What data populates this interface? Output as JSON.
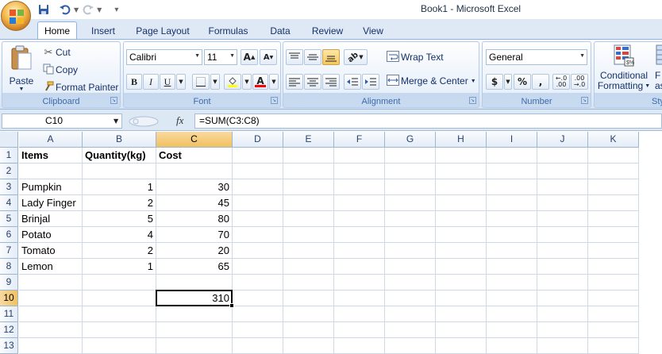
{
  "window": {
    "title": "Book1 - Microsoft Excel"
  },
  "qat": {
    "save_icon": "save-icon",
    "undo_icon": "undo-icon",
    "redo_icon": "redo-icon",
    "customize_icon": "customize-qat-icon"
  },
  "tabs": [
    {
      "label": "Home"
    },
    {
      "label": "Insert"
    },
    {
      "label": "Page Layout"
    },
    {
      "label": "Formulas"
    },
    {
      "label": "Data"
    },
    {
      "label": "Review"
    },
    {
      "label": "View"
    }
  ],
  "ribbon": {
    "clipboard": {
      "label": "Clipboard",
      "paste": "Paste",
      "cut": "Cut",
      "copy": "Copy",
      "format_painter": "Format Painter"
    },
    "font": {
      "label": "Font",
      "font_name": "Calibri",
      "font_size": "11"
    },
    "alignment": {
      "label": "Alignment",
      "wrap_text": "Wrap Text",
      "merge_center": "Merge & Center"
    },
    "number": {
      "label": "Number",
      "format": "General"
    },
    "styles": {
      "conditional_1": "Conditional",
      "conditional_2": "Formatting",
      "format_as_1": "F",
      "format_as_2": "as",
      "label": "Sty"
    }
  },
  "formula_bar": {
    "name_box": "C10",
    "formula": "=SUM(C3:C8)",
    "fx": "fx"
  },
  "grid": {
    "columns": [
      "A",
      "B",
      "C",
      "D",
      "E",
      "F",
      "G",
      "H",
      "I",
      "J",
      "K"
    ],
    "rows": [
      "1",
      "2",
      "3",
      "4",
      "5",
      "6",
      "7",
      "8",
      "9",
      "10",
      "11",
      "12",
      "13"
    ],
    "selected_cell": "C10",
    "cells": {
      "A1": "Items",
      "B1": "Quantity(kg)",
      "C1": "Cost",
      "A3": "Pumpkin",
      "B3": "1",
      "C3": "30",
      "A4": "Lady Finger",
      "B4": "2",
      "C4": "45",
      "A5": "Brinjal",
      "B5": "5",
      "C5": "80",
      "A6": "Potato",
      "B6": "4",
      "C6": "70",
      "A7": "Tomato",
      "B7": "2",
      "C7": "20",
      "A8": "Lemon",
      "B8": "1",
      "C8": "65",
      "C10": "310"
    }
  }
}
